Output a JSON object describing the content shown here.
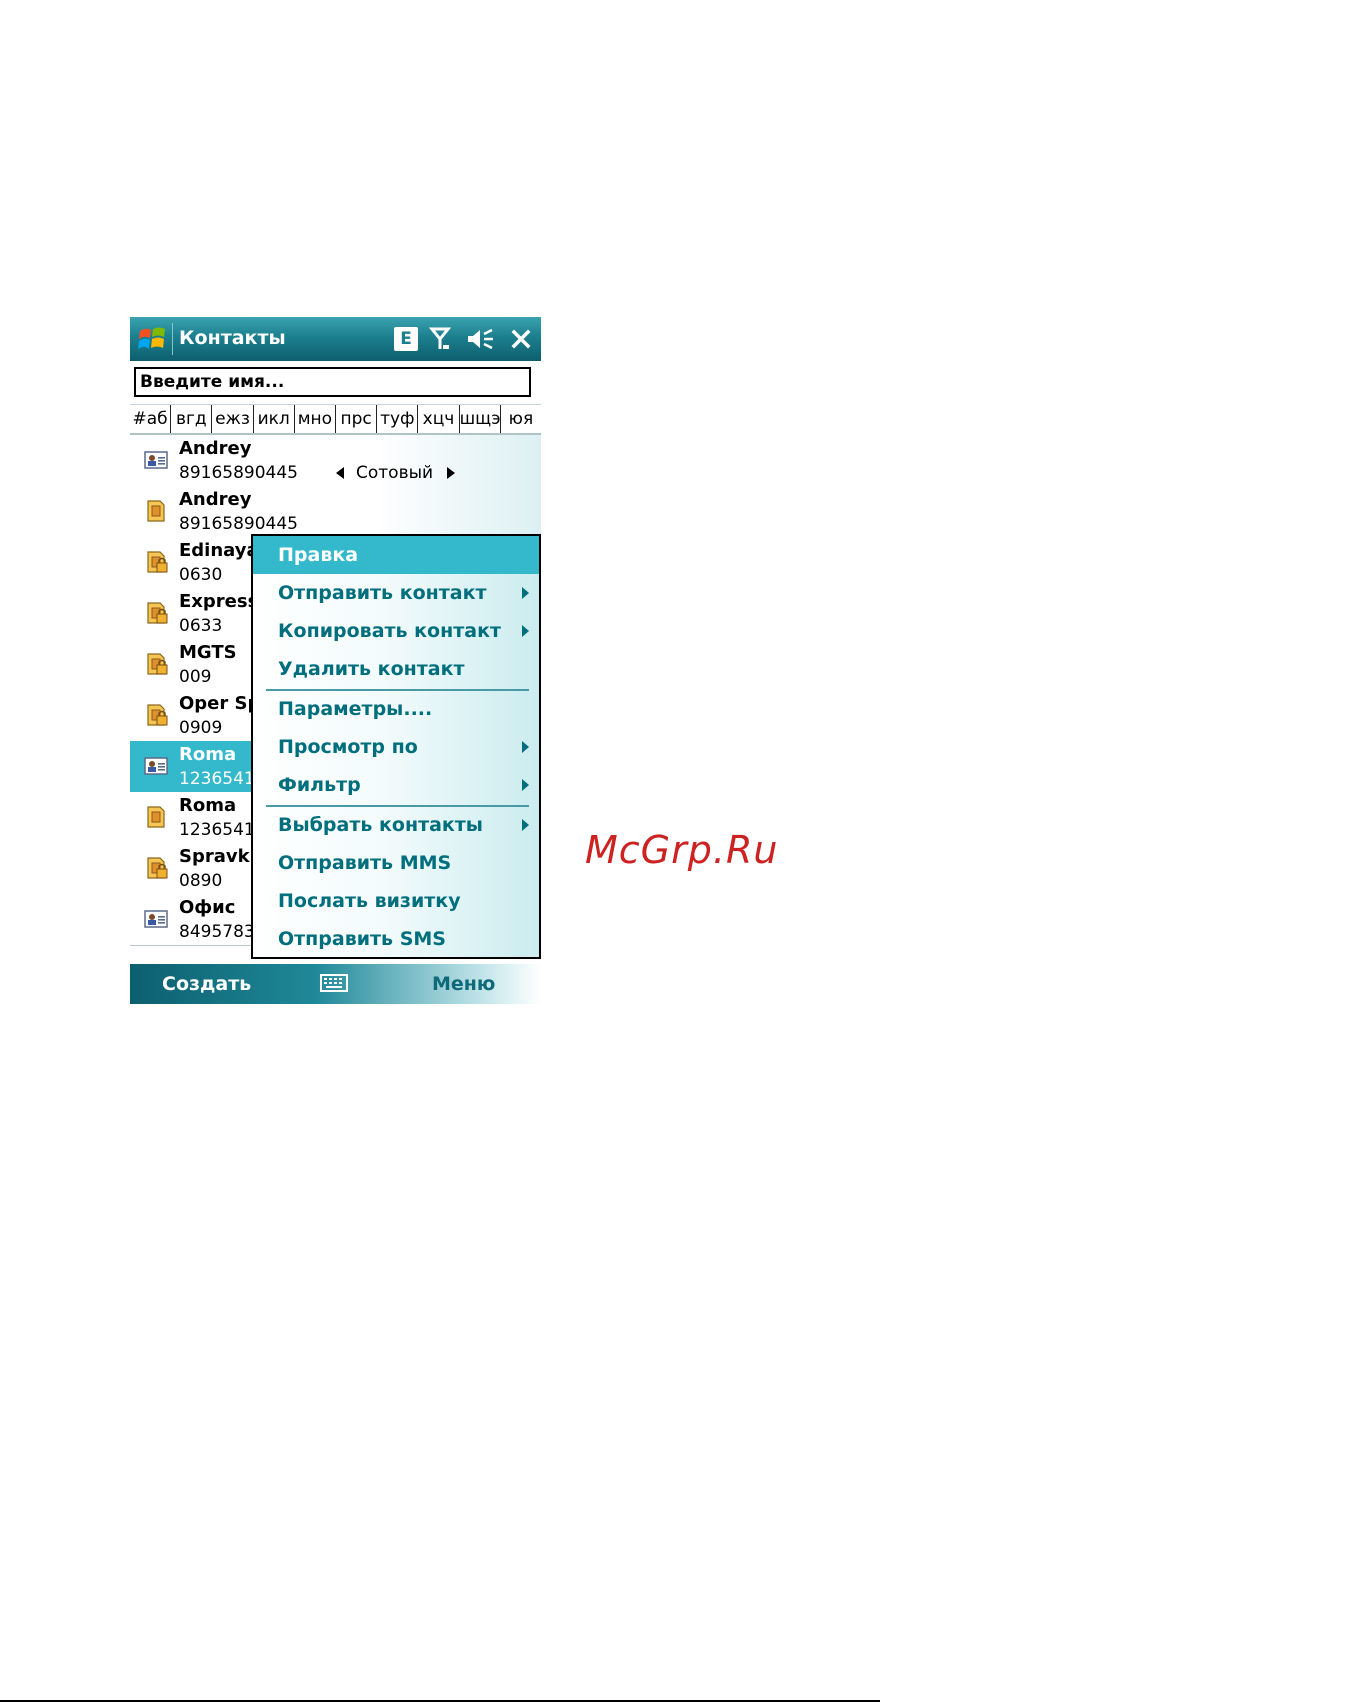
{
  "titlebar": {
    "title": "Контакты",
    "e_label": "E",
    "icons": [
      "windows-start-icon",
      "e-icon",
      "signal-icon",
      "speaker-muted-icon",
      "close-icon"
    ]
  },
  "search": {
    "placeholder": "Введите имя..."
  },
  "alphabet": [
    "#аб",
    "вгд",
    "ежз",
    "икл",
    "мно",
    "прс",
    "туф",
    "хцч",
    "шщэ",
    "юя"
  ],
  "contacts": [
    {
      "name": "Andrey",
      "number": "89165890445",
      "phone_type": "Сотовый",
      "icon": "contact-card-icon"
    },
    {
      "name": "Andrey",
      "number": "89165890445",
      "icon": "sim-contact-icon"
    },
    {
      "name": "Edinaya",
      "number": "0630",
      "icon": "sim-locked-contact-icon"
    },
    {
      "name": "Express",
      "number": "0633",
      "icon": "sim-locked-contact-icon"
    },
    {
      "name": "MGTS",
      "number": "009",
      "icon": "sim-locked-contact-icon"
    },
    {
      "name": "Oper Sp",
      "number": "0909",
      "icon": "sim-locked-contact-icon"
    },
    {
      "name": "Roma",
      "number": "1236541",
      "icon": "contact-card-icon",
      "selected": true
    },
    {
      "name": "Roma",
      "number": "1236541",
      "icon": "sim-contact-icon"
    },
    {
      "name": "Spravk",
      "number": "0890",
      "icon": "sim-locked-contact-icon"
    },
    {
      "name": "Офис",
      "number": "8495783",
      "icon": "contact-card-icon"
    }
  ],
  "menu": {
    "items": [
      {
        "label": "Правка",
        "highlighted": true
      },
      {
        "label": "Отправить контакт",
        "submenu": true
      },
      {
        "label": "Копировать контакт",
        "submenu": true
      },
      {
        "label": "Удалить контакт"
      },
      {
        "label": "Параметры....",
        "separator_before": true
      },
      {
        "label": "Просмотр по",
        "submenu": true
      },
      {
        "label": "Фильтр",
        "submenu": true
      },
      {
        "label": "Выбрать контакты",
        "submenu": true,
        "separator_before": true
      },
      {
        "label": "Отправить MMS"
      },
      {
        "label": "Послать визитку"
      },
      {
        "label": "Отправить SMS"
      }
    ]
  },
  "softkeys": {
    "left": "Создать",
    "right": "Меню"
  },
  "watermark": "McGrp.Ru",
  "colors": {
    "titlebar": "#1d7f8e",
    "highlight": "#34b9cc",
    "menu_text": "#006e7c",
    "watermark": "#cc2222"
  }
}
